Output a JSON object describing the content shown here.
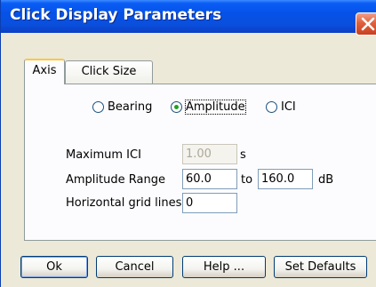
{
  "window": {
    "title": "Click Display Parameters"
  },
  "tabs": [
    {
      "label": "Axis",
      "active": true
    },
    {
      "label": "Click Size",
      "active": false
    }
  ],
  "axis": {
    "radios": [
      {
        "label": "Bearing",
        "selected": false
      },
      {
        "label": "Amplitude",
        "selected": true
      },
      {
        "label": "ICI",
        "selected": false
      }
    ],
    "max_ici": {
      "label": "Maximum ICI",
      "value": "1.00",
      "unit": "s",
      "enabled": false
    },
    "amplitude_range": {
      "label": "Amplitude Range",
      "min": "60.0",
      "separator": "to",
      "max": "160.0",
      "unit": "dB"
    },
    "grid_lines": {
      "label": "Horizontal grid lines",
      "value": "0"
    }
  },
  "buttons": {
    "ok": "Ok",
    "cancel": "Cancel",
    "help": "Help ...",
    "set_defaults": "Set Defaults"
  },
  "colors": {
    "titlebar": "#0652e8",
    "dialog_bg": "#ece9d8",
    "panel_bg": "#fcfcfe",
    "close_button": "#e0603e",
    "radio_dot": "#21a121",
    "active_tab_highlight": "#ffc83c"
  },
  "icons": {
    "close": "close-icon"
  }
}
